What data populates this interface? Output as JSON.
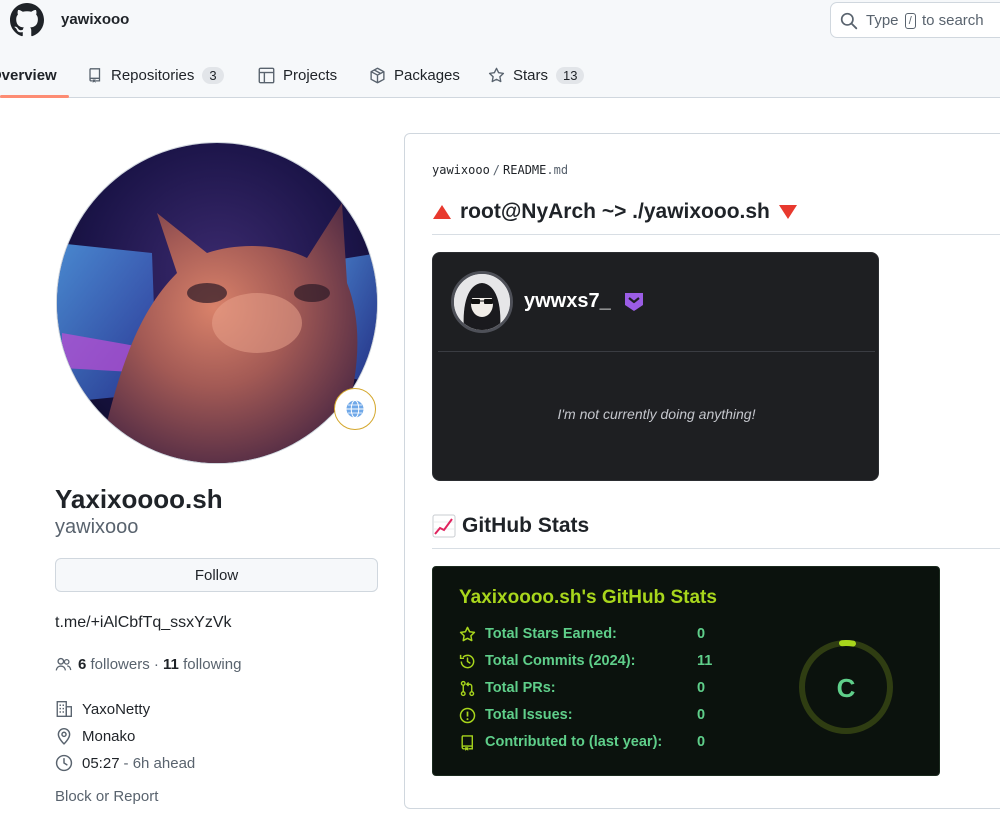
{
  "header": {
    "username": "yawixooo",
    "search_prefix": "Type",
    "search_key": "/",
    "search_suffix": "to search"
  },
  "tabs": [
    {
      "label": "Overview",
      "icon": "book-icon"
    },
    {
      "label": "Repositories",
      "count": "3",
      "icon": "repo-icon"
    },
    {
      "label": "Projects",
      "icon": "table-icon"
    },
    {
      "label": "Packages",
      "icon": "package-icon"
    },
    {
      "label": "Stars",
      "count": "13",
      "icon": "star-icon"
    }
  ],
  "profile": {
    "name": "Yaxixoooo.sh",
    "login": "yawixooo",
    "follow_label": "Follow",
    "bio": "t.me/+iAlCbfTq_ssxYzVk",
    "followers_count": "6",
    "followers_label": "followers",
    "following_count": "11",
    "following_label": "following",
    "company": "YaxoNetty",
    "location": "Monako",
    "time": "05:27",
    "time_note": "- 6h ahead",
    "block_label": "Block or Report"
  },
  "readme": {
    "crumb_user": "yawixooo",
    "crumb_file": "README",
    "crumb_ext": ".md",
    "heading1": "root@NyArch ~> ./yawixooo.sh",
    "heading2": "GitHub Stats",
    "discord": {
      "username": "ywwxs7_",
      "status": "I'm not currently doing anything!"
    },
    "stats": {
      "title": "Yaxixoooo.sh's GitHub Stats",
      "grade": "C",
      "rows": [
        {
          "label": "Total Stars Earned:",
          "value": "0",
          "icon": "star-icon"
        },
        {
          "label": "Total Commits (2024):",
          "value": "11",
          "icon": "history-icon"
        },
        {
          "label": "Total PRs:",
          "value": "0",
          "icon": "pull-request-icon"
        },
        {
          "label": "Total Issues:",
          "value": "0",
          "icon": "issue-icon"
        },
        {
          "label": "Contributed to (last year):",
          "value": "0",
          "icon": "repo-icon"
        }
      ]
    }
  },
  "colors": {
    "accent_tab": "#fd8c73",
    "stats_title": "#a8d61c",
    "stats_text": "#5fcf8a",
    "discord_bg": "#1e1f22"
  }
}
